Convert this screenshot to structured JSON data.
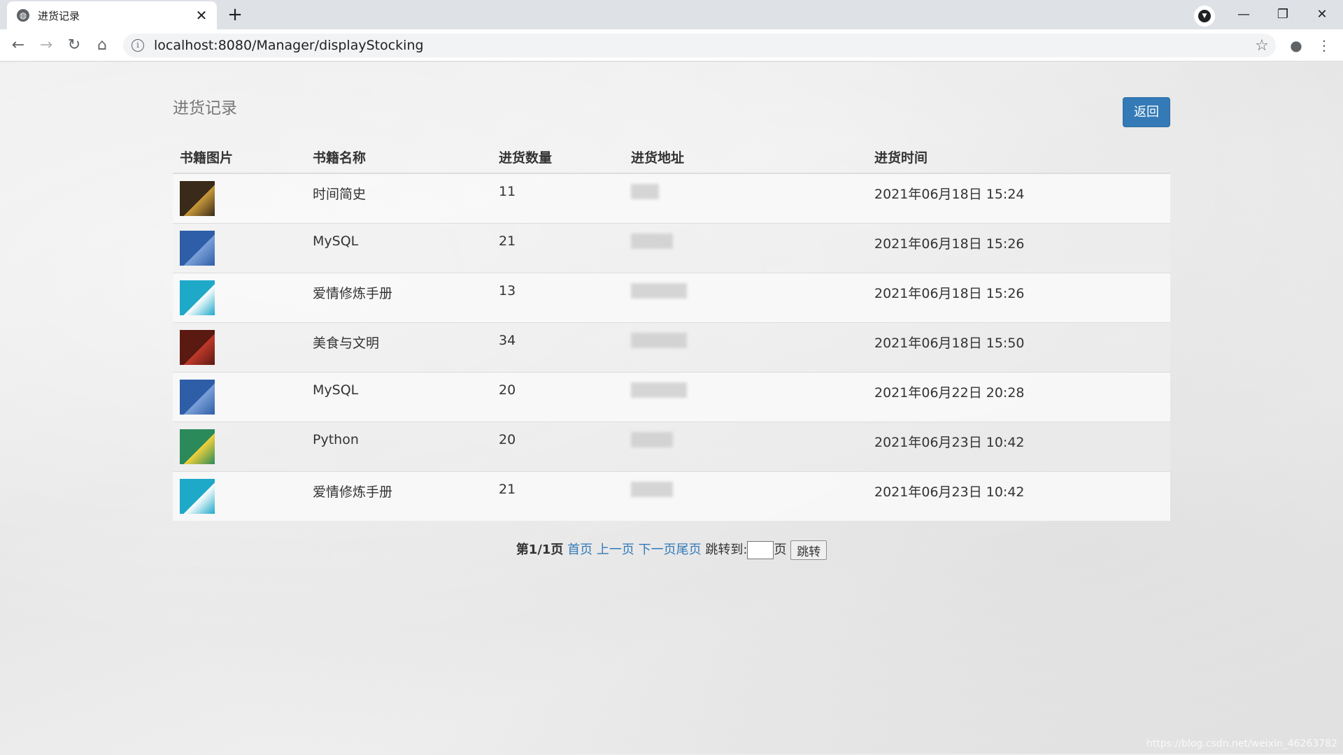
{
  "browser": {
    "tab_title": "进货记录",
    "tab_close": "✕",
    "new_tab": "+",
    "url": "localhost:8080/Manager/displayStocking",
    "window_controls": {
      "minimize": "—",
      "restore": "❐",
      "close": "✕"
    }
  },
  "page": {
    "title": "进货记录",
    "back_button": "返回"
  },
  "table": {
    "headers": [
      "书籍图片",
      "书籍名称",
      "进货数量",
      "进货地址",
      "进货时间"
    ],
    "rows": [
      {
        "name": "时间简史",
        "quantity": "11",
        "time": "2021年06月18日 15:24",
        "cover_color": "#3a2a1a",
        "cover_accent": "#c89a3a"
      },
      {
        "name": "MySQL",
        "quantity": "21",
        "time": "2021年06月18日 15:26",
        "cover_color": "#2f5ea8",
        "cover_accent": "#7aa0d8"
      },
      {
        "name": "爱情修炼手册",
        "quantity": "13",
        "time": "2021年06月18日 15:26",
        "cover_color": "#1fa9c9",
        "cover_accent": "#ffffff"
      },
      {
        "name": "美食与文明",
        "quantity": "34",
        "time": "2021年06月18日 15:50",
        "cover_color": "#5a1a12",
        "cover_accent": "#c0392b"
      },
      {
        "name": "MySQL",
        "quantity": "20",
        "time": "2021年06月22日 20:28",
        "cover_color": "#2f5ea8",
        "cover_accent": "#7aa0d8"
      },
      {
        "name": "Python",
        "quantity": "20",
        "time": "2021年06月23日 10:42",
        "cover_color": "#2a8a5a",
        "cover_accent": "#f2d13a"
      },
      {
        "name": "爱情修炼手册",
        "quantity": "21",
        "time": "2021年06月23日 10:42",
        "cover_color": "#1fa9c9",
        "cover_accent": "#ffffff"
      }
    ]
  },
  "pager": {
    "current": "第1/1页",
    "first": "首页",
    "prev": "上一页",
    "next": "下一页",
    "last": "尾页",
    "jump_prefix": "跳转到:",
    "jump_suffix": "页",
    "jump_button": "跳转"
  },
  "watermark": "https://blog.csdn.net/weixin_46263782",
  "colors": {
    "primary": "#337ab7",
    "link": "#337ab7"
  }
}
